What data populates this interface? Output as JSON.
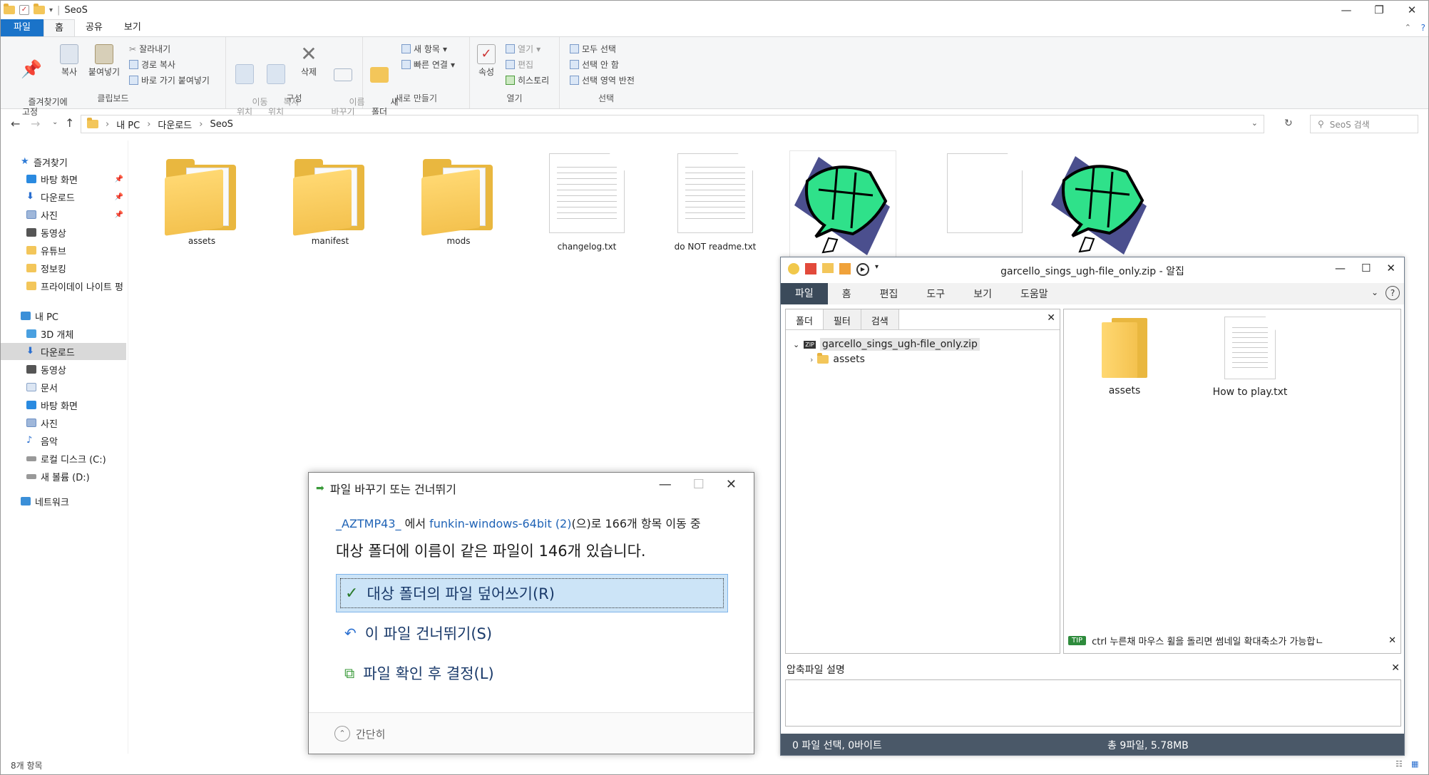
{
  "explorer": {
    "title": "SeoS",
    "menu_tabs": [
      "파일",
      "홈",
      "공유",
      "보기"
    ],
    "ribbon": {
      "clipboard": {
        "pin": "즐겨찾기에\n고정",
        "copy": "복사",
        "paste": "붙여넣기",
        "cut": "잘라내기",
        "copy_path": "경로 복사",
        "paste_shortcut": "바로 가기 붙여넣기",
        "label": "클립보드"
      },
      "organize": {
        "move_to": "이동\n위치",
        "copy_to": "복사\n위치",
        "delete": "삭제",
        "rename": "이름\n바꾸기",
        "label": "구성"
      },
      "new": {
        "new_folder": "새\n폴더",
        "new_item": "새 항목",
        "easy_access": "빠른 연결",
        "label": "새로 만들기"
      },
      "open": {
        "properties": "속성",
        "open": "열기",
        "edit": "편집",
        "history": "히스토리",
        "label": "열기"
      },
      "select": {
        "select_all": "모두 선택",
        "select_none": "선택 안 함",
        "invert": "선택 영역 반전",
        "label": "선택"
      }
    },
    "address": {
      "path": [
        "내 PC",
        "다운로드",
        "SeoS"
      ],
      "search_placeholder": "SeoS 검색"
    },
    "sidebar": [
      {
        "label": "즐겨찾기",
        "icon": "star-icon",
        "color": "#2e7bd6"
      },
      {
        "label": "바탕 화면",
        "icon": "desktop-icon",
        "color": "#2a8ae0",
        "pinned": true
      },
      {
        "label": "다운로드",
        "icon": "download-icon",
        "color": "#2a6fd0",
        "pinned": true
      },
      {
        "label": "사진",
        "icon": "pictures-icon",
        "color": "#6b8fc4",
        "pinned": true
      },
      {
        "label": "동영상",
        "icon": "video-icon",
        "color": "#555"
      },
      {
        "label": "유튜브",
        "icon": "folder-icon",
        "color": "#f3c65a"
      },
      {
        "label": "정보킹",
        "icon": "folder-icon",
        "color": "#f3c65a"
      },
      {
        "label": "프라이데이 나이트 펑",
        "icon": "folder-icon",
        "color": "#f3c65a"
      },
      {
        "label": "내 PC",
        "icon": "pc-icon",
        "color": "#3b8fd8"
      },
      {
        "label": "3D 개체",
        "icon": "3d-icon",
        "color": "#4aa0e0"
      },
      {
        "label": "다운로드",
        "icon": "download-icon",
        "color": "#2a6fd0"
      },
      {
        "label": "동영상",
        "icon": "video-icon",
        "color": "#555"
      },
      {
        "label": "문서",
        "icon": "documents-icon",
        "color": "#8aa4c8"
      },
      {
        "label": "바탕 화면",
        "icon": "desktop-icon",
        "color": "#2a8ae0"
      },
      {
        "label": "사진",
        "icon": "pictures-icon",
        "color": "#6b8fc4"
      },
      {
        "label": "음악",
        "icon": "music-icon",
        "color": "#2a6fd0"
      },
      {
        "label": "로컬 디스크 (C:)",
        "icon": "drive-icon",
        "color": "#777"
      },
      {
        "label": "새 볼륨 (D:)",
        "icon": "drive-icon",
        "color": "#777"
      },
      {
        "label": "네트워크",
        "icon": "network-icon",
        "color": "#3b8fd8"
      }
    ],
    "files": [
      {
        "name": "assets",
        "kind": "folder"
      },
      {
        "name": "manifest",
        "kind": "folder"
      },
      {
        "name": "mods",
        "kind": "folder"
      },
      {
        "name": "changelog.txt",
        "kind": "text"
      },
      {
        "name": "do NOT readme.txt",
        "kind": "text"
      },
      {
        "name": "",
        "kind": "image"
      },
      {
        "name": "",
        "kind": "blank"
      },
      {
        "name": "",
        "kind": "image"
      }
    ],
    "status": "8개 항목"
  },
  "zip": {
    "title": "garcello_sings_ugh-file_only.zip - 알집",
    "menu": [
      "파일",
      "홈",
      "편집",
      "도구",
      "보기",
      "도움말"
    ],
    "pane_tabs": [
      "폴더",
      "필터",
      "검색"
    ],
    "tree_root": "garcello_sings_ugh-file_only.zip",
    "tree_child": "assets",
    "items": [
      {
        "name": "assets",
        "kind": "folder"
      },
      {
        "name": "How to play.txt",
        "kind": "text"
      }
    ],
    "tip_badge": "TIP",
    "tip": "ctrl 누른채 마우스 휠을 돌리면 썸네일 확대축소가 가능합ㄴ",
    "desc_title": "압축파일 설명",
    "status_left": "0 파일 선택,  0바이트",
    "status_right": "총 9파일,  5.78MB"
  },
  "dialog": {
    "title": "파일 바꾸기 또는 건너뛰기",
    "src": "_AZTMP43_",
    "from_word": "에서",
    "dest": "funkin-windows-64bit (2)",
    "tail": "(으)로 166개 항목 이동 중",
    "message": "대상 폴더에 이름이 같은 파일이 146개 있습니다.",
    "opt_replace": "대상 폴더의 파일 덮어쓰기(R)",
    "opt_skip": "이 파일 건너뛰기(S)",
    "opt_decide": "파일 확인 후 결정(L)",
    "fewer": "간단히"
  }
}
